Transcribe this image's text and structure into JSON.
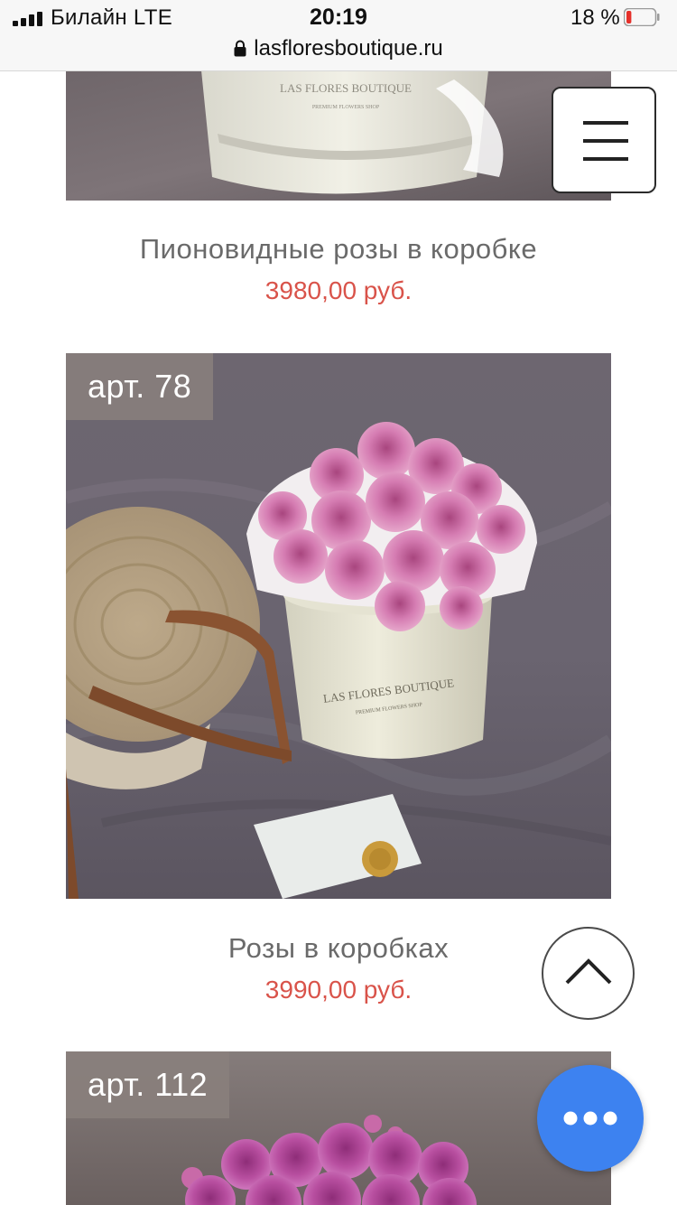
{
  "status_bar": {
    "carrier": "Билайн  LTE",
    "time": "20:19",
    "battery_percent": "18 %",
    "battery_level": 0.18,
    "url": "lasfloresboutique.ru"
  },
  "products": [
    {
      "article": "",
      "title": "Пионовидные розы в коробке",
      "price": "3980,00 руб.",
      "image": "white-hat-box-photo"
    },
    {
      "article": "арт. 78",
      "title": "Розы в коробках",
      "price": "3990,00 руб.",
      "image": "pink-roses-in-box-photo",
      "box_brand": "LAS FLORES BOUTIQUE",
      "box_tagline": "PREMIUM FLOWERS SHOP"
    },
    {
      "article": "арт. 112",
      "title": "",
      "price": "",
      "image": "purple-roses-photo"
    }
  ],
  "header_box_brand": "LAS FLORES BOUTIQUE",
  "header_box_tagline": "PREMIUM FLOWERS SHOP",
  "colors": {
    "price": "#d9534a",
    "badge": "#8a807c",
    "chat_button": "#3d82f0",
    "battery_low": "#e5302a"
  },
  "icons": {
    "menu": "hamburger-icon",
    "scroll_top": "chevron-up-icon",
    "chat": "dots-icon",
    "lock": "lock-icon"
  }
}
